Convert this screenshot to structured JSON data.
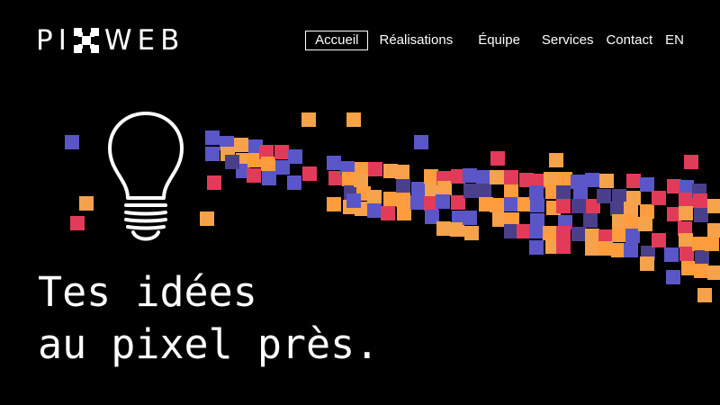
{
  "brand": {
    "logo_left": "PI",
    "logo_right": "WEB"
  },
  "nav": {
    "items": [
      {
        "label": "Accueil",
        "active": true
      },
      {
        "label": "Réalisations",
        "active": false
      },
      {
        "label": "Équipe",
        "active": false
      },
      {
        "label": "Services",
        "active": false
      },
      {
        "label": "Contact",
        "active": false
      }
    ],
    "language": "EN"
  },
  "hero": {
    "headline_line1": "Tes idées",
    "headline_line2": "au pixel près.",
    "illustration": "lightbulb-icon"
  },
  "colors": {
    "background": "#000000",
    "text": "#ffffff",
    "pixel_palette": [
      "#f6a24b",
      "#e23b5a",
      "#5a56c7",
      "#4a3f8a",
      "#ff9c3d"
    ]
  }
}
